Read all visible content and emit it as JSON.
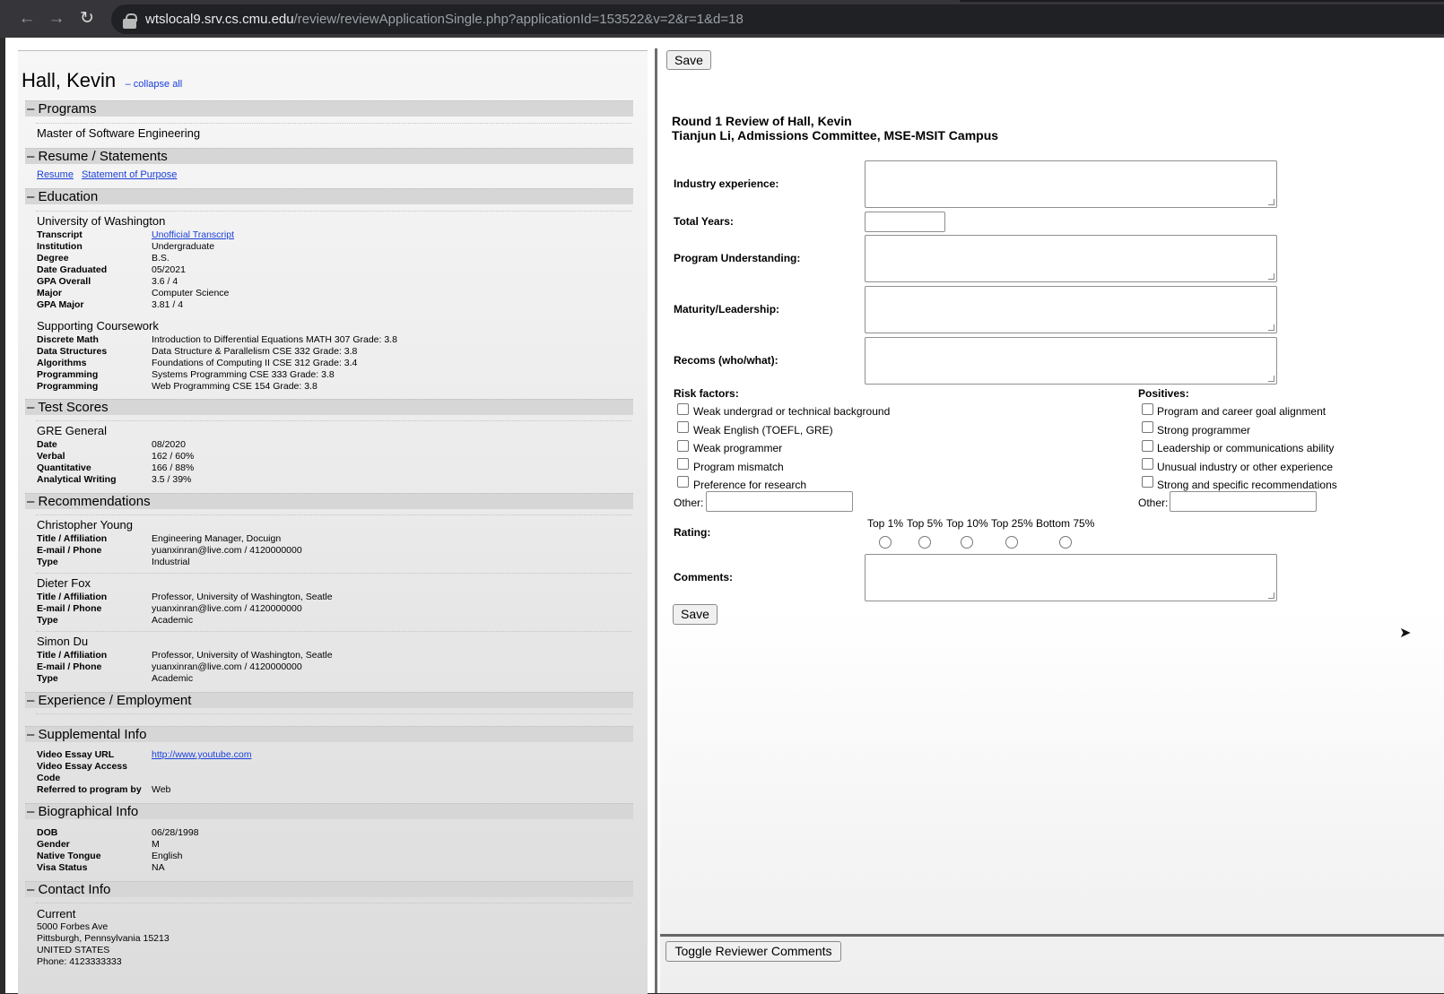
{
  "browser": {
    "url_host": "wtslocal9.srv.cs.cmu.edu",
    "url_path": "/review/reviewApplicationSingle.php?applicationId=153522&v=2&r=1&d=18"
  },
  "applicant": {
    "name": "Hall, Kevin",
    "collapse_all": "– collapse all"
  },
  "sections": {
    "programs": "– Programs",
    "resume": "– Resume / Statements",
    "education": "– Education",
    "test_scores": "– Test Scores",
    "recommendations": "– Recommendations",
    "experience": "– Experience / Employment",
    "supplemental": "– Supplemental Info",
    "bio": "– Biographical Info",
    "contact": "– Contact Info"
  },
  "programs": {
    "program": "Master of Software Engineering"
  },
  "resume": {
    "resume_link": "Resume",
    "sop_link": "Statement of Purpose"
  },
  "education": {
    "school": "University of Washington",
    "rows": [
      {
        "label": "Transcript",
        "value": "Unofficial Transcript"
      },
      {
        "label": "Institution",
        "value": "Undergraduate"
      },
      {
        "label": "Degree",
        "value": "B.S."
      },
      {
        "label": "Date Graduated",
        "value": "05/2021"
      },
      {
        "label": "GPA Overall",
        "value": "3.6 / 4"
      },
      {
        "label": "Major",
        "value": "Computer Science"
      },
      {
        "label": "GPA Major",
        "value": "3.81 / 4"
      }
    ],
    "coursework_title": "Supporting Coursework",
    "coursework": [
      {
        "label": "Discrete Math",
        "value": "Introduction to Differential Equations MATH 307 Grade: 3.8"
      },
      {
        "label": "Data Structures",
        "value": "Data Structure & Parallelism CSE 332 Grade: 3.8"
      },
      {
        "label": "Algorithms",
        "value": "Foundations of Computing II CSE 312 Grade: 3.4"
      },
      {
        "label": "Programming",
        "value": "Systems Programming CSE 333 Grade: 3.8"
      },
      {
        "label": "Programming",
        "value": "Web Programming CSE 154 Grade: 3.8"
      }
    ]
  },
  "test_scores": {
    "title": "GRE General",
    "rows": [
      {
        "label": "Date",
        "value": "08/2020"
      },
      {
        "label": "Verbal",
        "value": "162 / 60%"
      },
      {
        "label": "Quantitative",
        "value": "166 / 88%"
      },
      {
        "label": "Analytical Writing",
        "value": "3.5 / 39%"
      }
    ]
  },
  "recommenders": [
    {
      "name": "Christopher Young",
      "rows": [
        {
          "label": "Title / Affiliation",
          "value": "Engineering Manager, Docuign"
        },
        {
          "label": "E-mail / Phone",
          "value": "yuanxinran@live.com / 4120000000"
        },
        {
          "label": "Type",
          "value": "Industrial"
        }
      ]
    },
    {
      "name": "Dieter Fox",
      "rows": [
        {
          "label": "Title / Affiliation",
          "value": "Professor, University of Washington, Seatle"
        },
        {
          "label": "E-mail / Phone",
          "value": "yuanxinran@live.com / 4120000000"
        },
        {
          "label": "Type",
          "value": "Academic"
        }
      ]
    },
    {
      "name": "Simon Du",
      "rows": [
        {
          "label": "Title / Affiliation",
          "value": "Professor, University of Washington, Seatle"
        },
        {
          "label": "E-mail / Phone",
          "value": "yuanxinran@live.com / 4120000000"
        },
        {
          "label": "Type",
          "value": "Academic"
        }
      ]
    }
  ],
  "supplemental": {
    "video_url_label": "Video Essay URL",
    "video_url": "http://www.youtube.com",
    "access_label_1": "Video Essay Access",
    "access_label_2": "Code",
    "referred_label": "Referred to program by",
    "referred_value": "Web"
  },
  "bio": [
    {
      "label": "DOB",
      "value": "06/28/1998"
    },
    {
      "label": "Gender",
      "value": "M"
    },
    {
      "label": "Native Tongue",
      "value": "English"
    },
    {
      "label": "Visa Status",
      "value": "NA"
    }
  ],
  "contact": {
    "title": "Current",
    "lines": [
      "5000 Forbes Ave",
      "Pittsburgh, Pennsylvania 15213",
      "UNITED STATES",
      "Phone: 4123333333"
    ]
  },
  "review": {
    "save_top": "Save",
    "heading_1": "Round 1 Review of Hall, Kevin",
    "heading_2": "Tianjun Li, Admissions Committee, MSE-MSIT Campus",
    "industry_label": "Industry experience:",
    "total_years_label": "Total Years:",
    "program_understanding_label": "Program Understanding:",
    "maturity_label": "Maturity/Leadership:",
    "recoms_label": "Recoms (who/what):",
    "risk_title": "Risk factors:",
    "risks": [
      "Weak undergrad or technical background",
      "Weak English (TOEFL, GRE)",
      "Weak programmer",
      "Program mismatch",
      "Preference for research"
    ],
    "positives_title": "Positives:",
    "positives": [
      "Program and career goal alignment",
      "Strong programmer",
      "Leadership or communications ability",
      "Unusual industry or other experience",
      "Strong and specific recommendations"
    ],
    "other_label": "Other:",
    "rating_label": "Rating:",
    "ratings": [
      "Top 1%",
      "Top 5%",
      "Top 10%",
      "Top 25%",
      "Bottom 75%"
    ],
    "comments_label": "Comments:",
    "save_bottom": "Save",
    "toggle_comments": "Toggle Reviewer Comments"
  }
}
